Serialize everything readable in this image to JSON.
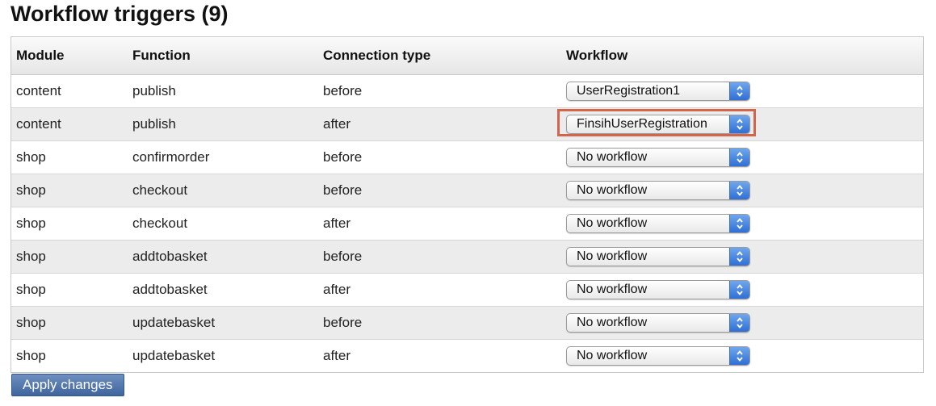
{
  "page": {
    "title": "Workflow triggers (9)"
  },
  "table": {
    "headers": {
      "module": "Module",
      "function": "Function",
      "connection_type": "Connection type",
      "workflow": "Workflow"
    },
    "rows": [
      {
        "module": "content",
        "function": "publish",
        "connection_type": "before",
        "workflow": "UserRegistration1"
      },
      {
        "module": "content",
        "function": "publish",
        "connection_type": "after",
        "workflow": "FinsihUserRegistration",
        "highlighted": true
      },
      {
        "module": "shop",
        "function": "confirmorder",
        "connection_type": "before",
        "workflow": "No workflow"
      },
      {
        "module": "shop",
        "function": "checkout",
        "connection_type": "before",
        "workflow": "No workflow"
      },
      {
        "module": "shop",
        "function": "checkout",
        "connection_type": "after",
        "workflow": "No workflow"
      },
      {
        "module": "shop",
        "function": "addtobasket",
        "connection_type": "before",
        "workflow": "No workflow"
      },
      {
        "module": "shop",
        "function": "addtobasket",
        "connection_type": "after",
        "workflow": "No workflow"
      },
      {
        "module": "shop",
        "function": "updatebasket",
        "connection_type": "before",
        "workflow": "No workflow"
      },
      {
        "module": "shop",
        "function": "updatebasket",
        "connection_type": "after",
        "workflow": "No workflow"
      }
    ]
  },
  "actions": {
    "apply_label": "Apply changes"
  },
  "colors": {
    "highlight_border": "#d2664d",
    "select_arrow": "#2f6fd6",
    "apply_button": "#4a6fa8"
  },
  "icons": {
    "select_arrows": "up-down-chevron-icon"
  }
}
